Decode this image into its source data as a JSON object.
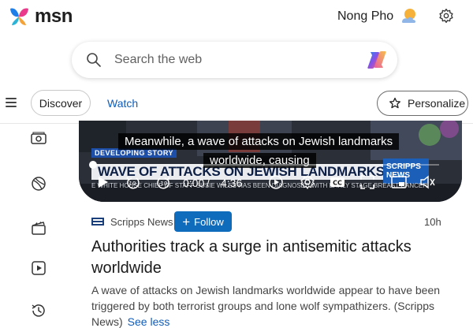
{
  "header": {
    "brand": "msn",
    "user_name": "Nong Pho"
  },
  "search": {
    "placeholder": "Search the web"
  },
  "nav": {
    "tabs": [
      {
        "label": "Discover",
        "selected": true
      },
      {
        "label": "Watch",
        "selected": false
      }
    ],
    "personalize_label": "Personalize"
  },
  "rail": {
    "icons": [
      "money-icon",
      "sports-icon",
      "movies-icon",
      "video-icon",
      "history-icon"
    ]
  },
  "video": {
    "caption_line1": "Meanwhile, a wave of attacks on Jewish landmarks",
    "caption_line2": "worldwide, causing",
    "banner_tag": "DEVELOPING STORY",
    "banner_headline": "WAVE OF ATTACKS ON JEWISH LANDMARKS",
    "channel_tag": "SCRIPPS NEWS",
    "ticker": "E WHITE HOUSE CHIEF OF STAFF SUSIE WILES HAS BEEN DIAGNOSED WITH EARLY STAGE BREAST CANCER",
    "current_time": "0:00",
    "separator": "/",
    "duration": "4:36",
    "progress": 0
  },
  "article": {
    "source": "Scripps News",
    "follow_label": "Follow",
    "time_ago": "10h",
    "title": "Authorities track a surge in antisemitic attacks worldwide",
    "summary": "A wave of attacks on Jewish landmarks worldwide appear to have been triggered by both terrorist groups and lone wolf sympathizers. (Scripps News)",
    "see_more": "See less"
  },
  "colors": {
    "accent": "#0f6cbd",
    "link": "#0f5cb8"
  }
}
